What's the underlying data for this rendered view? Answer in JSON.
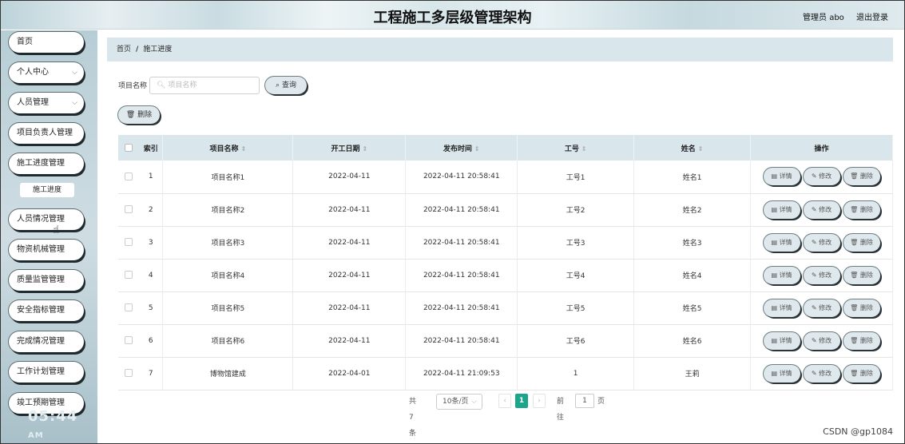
{
  "header": {
    "title": "工程施工多层级管理架构",
    "user": "管理员 abo",
    "logout": "退出登录"
  },
  "sidebar": {
    "items": [
      {
        "label": "首页"
      },
      {
        "label": "个人中心"
      },
      {
        "label": "人员管理"
      },
      {
        "label": "项目负责人管理"
      },
      {
        "label": "施工进度管理"
      },
      {
        "label": "人员情况管理"
      },
      {
        "label": "物资机械管理"
      },
      {
        "label": "质量监管管理"
      },
      {
        "label": "安全指标管理"
      },
      {
        "label": "完成情况管理"
      },
      {
        "label": "工作计划管理"
      },
      {
        "label": "竣工预期管理"
      }
    ],
    "sub_item": "施工进度",
    "clock": "05:44",
    "clock_suffix": "AM"
  },
  "breadcrumb": {
    "home": "首页",
    "separator": "/",
    "current": "施工进度"
  },
  "search": {
    "label": "项目名称",
    "placeholder": "项目名称",
    "query_button": "查询",
    "delete_button": "删除"
  },
  "table": {
    "headers": [
      "索引",
      "项目名称",
      "开工日期",
      "发布时间",
      "工号",
      "姓名",
      "操作"
    ],
    "rows": [
      {
        "index": "1",
        "name": "项目名称1",
        "start": "2022-04-11",
        "publish": "2022-04-11 20:58:41",
        "job_no": "工号1",
        "person": "姓名1"
      },
      {
        "index": "2",
        "name": "项目名称2",
        "start": "2022-04-11",
        "publish": "2022-04-11 20:58:41",
        "job_no": "工号2",
        "person": "姓名2"
      },
      {
        "index": "3",
        "name": "项目名称3",
        "start": "2022-04-11",
        "publish": "2022-04-11 20:58:41",
        "job_no": "工号3",
        "person": "姓名3"
      },
      {
        "index": "4",
        "name": "项目名称4",
        "start": "2022-04-11",
        "publish": "2022-04-11 20:58:41",
        "job_no": "工号4",
        "person": "姓名4"
      },
      {
        "index": "5",
        "name": "项目名称5",
        "start": "2022-04-11",
        "publish": "2022-04-11 20:58:41",
        "job_no": "工号5",
        "person": "姓名5"
      },
      {
        "index": "6",
        "name": "项目名称6",
        "start": "2022-04-11",
        "publish": "2022-04-11 20:58:41",
        "job_no": "工号6",
        "person": "姓名6"
      },
      {
        "index": "7",
        "name": "博物馆建成",
        "start": "2022-04-01",
        "publish": "2022-04-11 21:09:53",
        "job_no": "1",
        "person": "王莉"
      }
    ],
    "actions": {
      "detail": "详情",
      "edit": "修改",
      "delete": "删除"
    }
  },
  "pagination": {
    "total": "共 7 条",
    "page_size": "10条/页",
    "current_page": "1",
    "goto_label": "前往",
    "goto_value": "1",
    "page_unit": "页"
  },
  "watermark": "CSDN @gp1084"
}
